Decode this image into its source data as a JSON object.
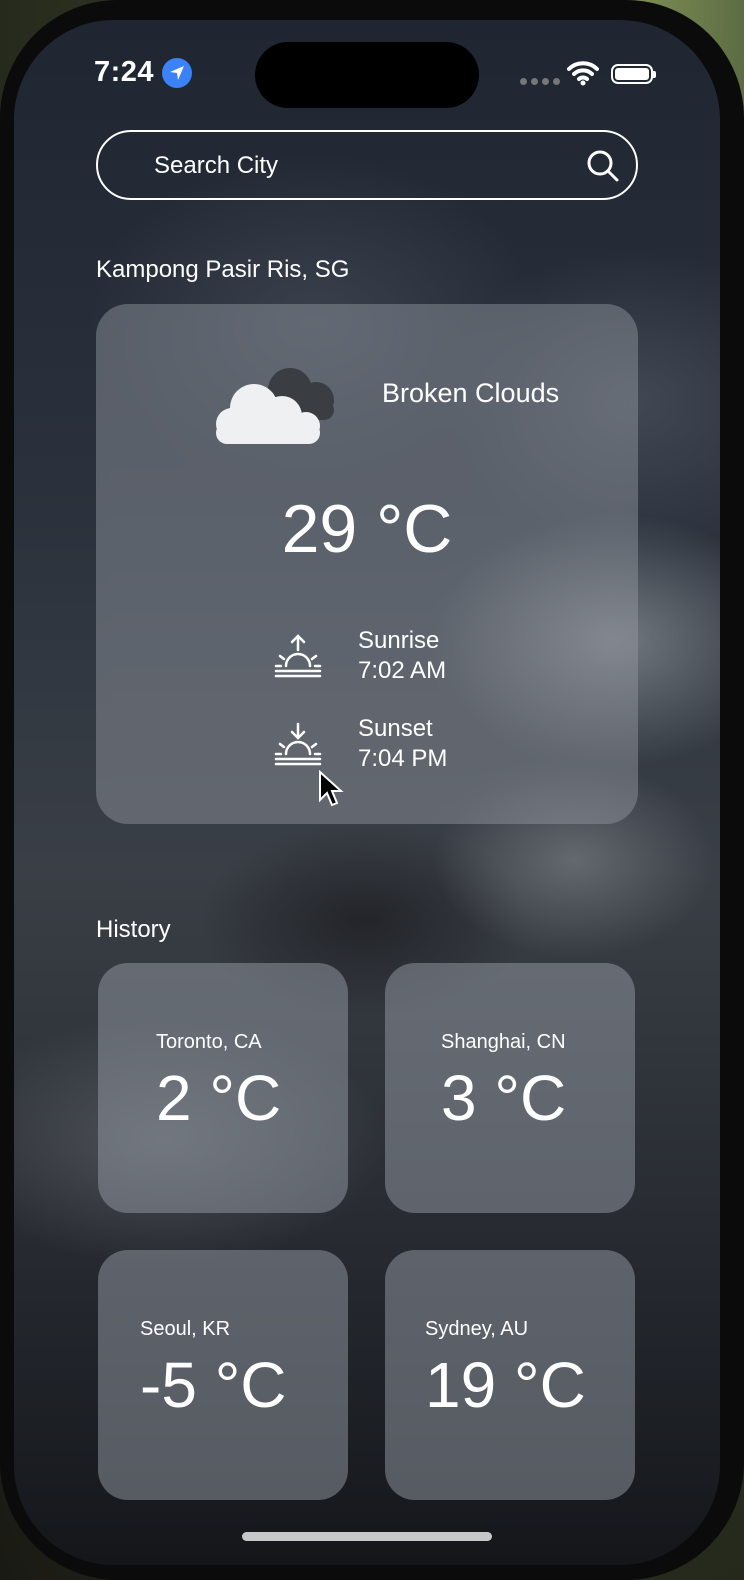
{
  "status_bar": {
    "time": "7:24"
  },
  "search": {
    "placeholder": "Search City"
  },
  "current": {
    "location": "Kampong Pasir Ris, SG",
    "condition": "Broken Clouds",
    "temperature": "29 °C",
    "sunrise_label": "Sunrise",
    "sunrise_time": "7:02 AM",
    "sunset_label": "Sunset",
    "sunset_time": "7:04 PM",
    "icon": "broken-clouds-icon"
  },
  "history": {
    "title": "History",
    "items": [
      {
        "city": "Toronto, CA",
        "temp": "2 °C"
      },
      {
        "city": "Shanghai, CN",
        "temp": "3 °C"
      },
      {
        "city": "Seoul, KR",
        "temp": "-5 °C"
      },
      {
        "city": "Sydney, AU",
        "temp": "19 °C"
      }
    ]
  },
  "colors": {
    "location_icon": "#3b82f6"
  }
}
